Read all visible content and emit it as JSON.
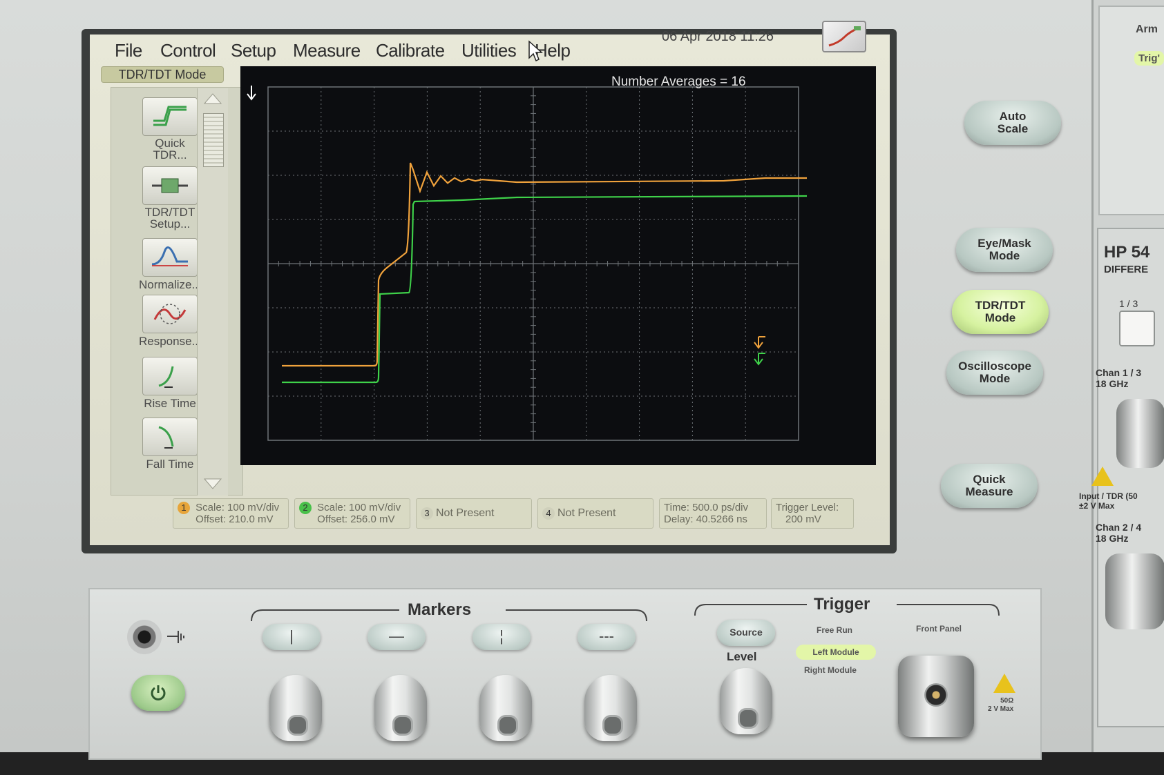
{
  "menu": {
    "items": [
      "File",
      "Control",
      "Setup",
      "Measure",
      "Calibrate",
      "Utilities",
      "Help"
    ],
    "datetime": "06 Apr 2018   11:26"
  },
  "mode_tab": "TDR/TDT Mode",
  "toolbar": {
    "tools": [
      {
        "label": "Quick\nTDR..."
      },
      {
        "label": "TDR/TDT\nSetup..."
      },
      {
        "label": "Normalize..."
      },
      {
        "label": "Response..."
      },
      {
        "label": "Rise Time"
      },
      {
        "label": "Fall Time"
      }
    ]
  },
  "plot": {
    "averages_label": "Number Averages = 16"
  },
  "status": {
    "ch1": {
      "num": "1",
      "scale": "Scale: 100 mV/div",
      "offset": "Offset: 210.0 mV",
      "color": "#e7a53a"
    },
    "ch2": {
      "num": "2",
      "scale": "Scale: 100 mV/div",
      "offset": "Offset: 256.0 mV",
      "color": "#49c04a"
    },
    "ch3": {
      "num": "3",
      "text": "Not Present"
    },
    "ch4": {
      "num": "4",
      "text": "Not Present"
    },
    "time": {
      "line1": "Time: 500.0 ps/div",
      "line2": "Delay: 40.5266 ns"
    },
    "trigger": {
      "line1": "Trigger Level:",
      "line2": "200 mV"
    }
  },
  "right_buttons": {
    "auto_scale": "Auto\nScale",
    "eye_mask": "Eye/Mask\nMode",
    "tdr_tdt": "TDR/TDT\nMode",
    "oscilloscope": "Oscilloscope\nMode",
    "quick_measure": "Quick\nMeasure"
  },
  "module": {
    "arm": "Arm",
    "trig": "Trig'",
    "title": "HP 54",
    "subtitle": "DIFFERE",
    "sel": "1 / 3",
    "chan13": "Chan  1 / 3\n18 GHz",
    "chan24": "Chan  2 / 4\n18 GHz",
    "input1": "Input / TDR  (50\n±2 V Max",
    "input2": "Input / TDR  (50\n±2 V Max"
  },
  "lower": {
    "markers_title": "Markers",
    "trigger_title": "Trigger",
    "marker_buttons": [
      "|",
      "—",
      "¦",
      "---"
    ],
    "source": "Source",
    "level": "Level",
    "free_run": "Free Run",
    "left_module": "Left Module",
    "right_module": "Right Module",
    "front_panel": "Front Panel",
    "conn_rating": "50Ω\n2 V Max"
  },
  "colors": {
    "trace1": "#f0a23c",
    "trace2": "#3fd24a",
    "grid": "#6f7478"
  }
}
